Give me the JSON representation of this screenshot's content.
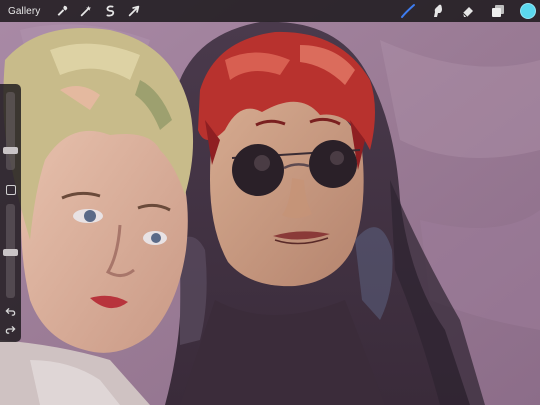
{
  "app": {
    "gallery_label": "Gallery"
  },
  "toolbar": {
    "left_tools": [
      "wrench-icon",
      "magic-wand-icon",
      "selection-icon",
      "transform-arrow-icon"
    ],
    "right_tools": [
      "brush-icon",
      "smudge-icon",
      "eraser-icon",
      "layers-icon"
    ],
    "active_tool": "brush-icon",
    "active_color": "#5bd9ee",
    "accent": "#3d7cf0"
  },
  "sidebar": {
    "brush_size": 0.22,
    "opacity": 0.48
  }
}
